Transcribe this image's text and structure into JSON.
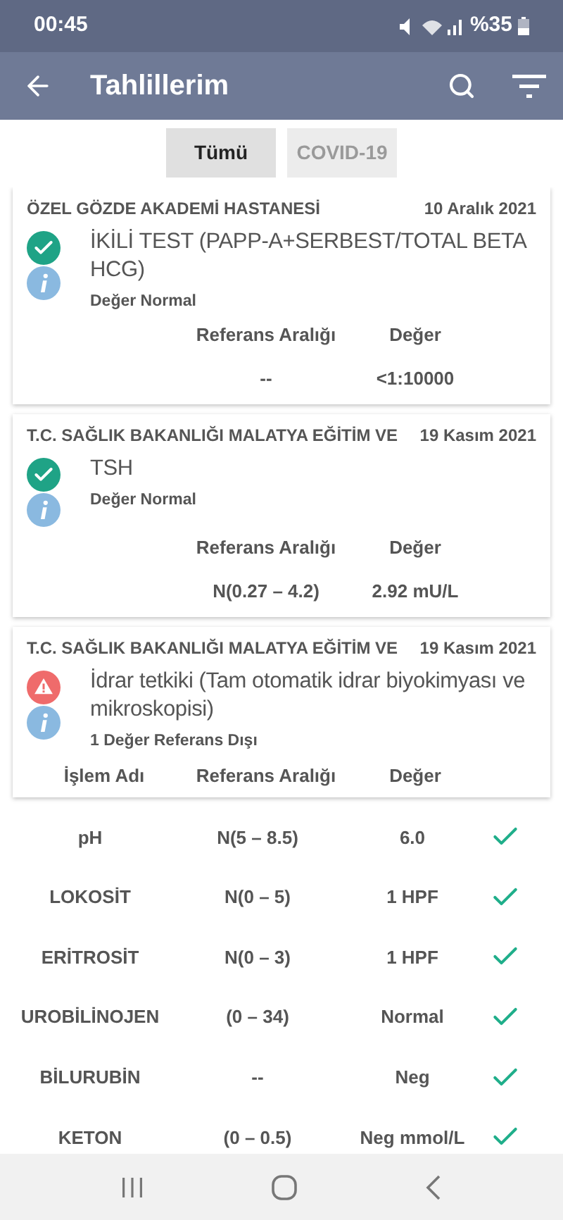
{
  "status_bar": {
    "time": "00:45",
    "battery": "%35"
  },
  "app_bar": {
    "title": "Tahlillerim"
  },
  "filters": [
    {
      "label": "Tümü",
      "selected": true
    },
    {
      "label": "COVID-19",
      "selected": false
    }
  ],
  "results": [
    {
      "hospital": "ÖZEL GÖZDE AKADEMİ HASTANESİ",
      "date": "10 Aralık 2021",
      "kind": "normal",
      "title": "İKİLİ TEST (PAPP-A+SERBEST/TOTAL BETA HCG)",
      "summary": "Değer Normal",
      "columns": [
        "Referans Aralığı",
        "Değer"
      ],
      "rows": [
        {
          "cells": [
            "--",
            "<1:10000"
          ]
        }
      ]
    },
    {
      "hospital": "T.C. SAĞLIK BAKANLIĞI MALATYA EĞİTİM VE",
      "date": "19 Kasım 2021",
      "kind": "normal",
      "title": "TSH",
      "summary": "Değer Normal",
      "columns": [
        "Referans Aralığı",
        "Değer"
      ],
      "rows": [
        {
          "cells": [
            "N(0.27 – 4.2)",
            "2.92 mU/L"
          ]
        }
      ]
    },
    {
      "hospital": "T.C. SAĞLIK BAKANLIĞI MALATYA EĞİTİM VE",
      "date": "19 Kasım 2021",
      "kind": "abnormal",
      "title": "İdrar tetkiki (Tam otomatik idrar biyokimyası ve mikroskopisi)",
      "summary": "1 Değer Referans Dışı",
      "columns": [
        "İşlem Adı",
        "Referans Aralığı",
        "Değer"
      ]
    }
  ],
  "detail_rows": [
    {
      "name": "pH",
      "range": "N(5 – 8.5)",
      "value": "6.0",
      "normal": true
    },
    {
      "name": "LOKOSİT",
      "range": "N(0 – 5)",
      "value": "1 HPF",
      "normal": true
    },
    {
      "name": "ERİTROSİT",
      "range": "N(0 – 3)",
      "value": "1 HPF",
      "normal": true
    },
    {
      "name": "UROBİLİNOJEN",
      "range": "(0 – 34)",
      "value": "Normal",
      "normal": true
    },
    {
      "name": "BİLURUBİN",
      "range": "--",
      "value": "Neg",
      "normal": true
    },
    {
      "name": "KETON",
      "range": "(0 – 0.5)",
      "value": "Neg mmol/L",
      "normal": true
    }
  ]
}
